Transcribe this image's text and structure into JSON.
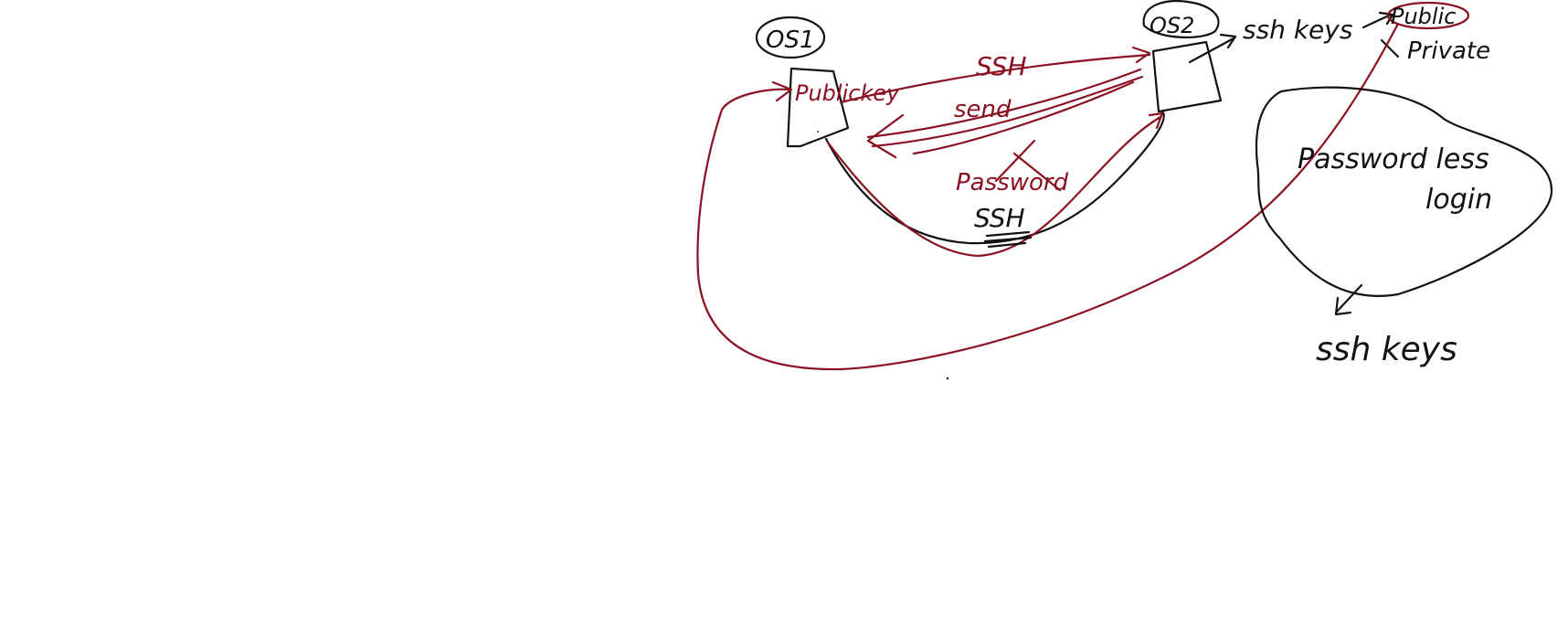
{
  "colors": {
    "black_ink": "#111111",
    "red_ink": "#8b1020",
    "background": "#ffffff"
  },
  "nodes": {
    "os1": {
      "label": "OS1"
    },
    "os2": {
      "label": "OS2"
    }
  },
  "labels": {
    "ssh_top": "SSH",
    "send": "send",
    "public_key": "Publickey",
    "password": "Password",
    "ssh_bottom": "SSH",
    "ssh_keys_os2": "ssh keys",
    "public": "Public",
    "private": "Private",
    "passwordless_line1": "Password less",
    "passwordless_line2": "login",
    "ssh_keys_bottom": "ssh keys"
  }
}
